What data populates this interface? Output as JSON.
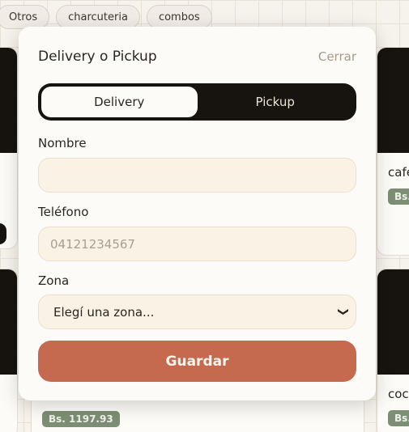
{
  "categories": [
    "Otros",
    "charcuteria",
    "combos"
  ],
  "background": {
    "right_card_1_name": "cafe",
    "right_card_1_price": "Bs.",
    "right_card_2_name": "coc",
    "right_card_2_price": "Bs.",
    "bottom_card_price": "Bs. 1197.93"
  },
  "modal": {
    "title": "Delivery o Pickup",
    "close_label": "Cerrar",
    "toggle": {
      "delivery": "Delivery",
      "pickup": "Pickup",
      "selected": "delivery"
    },
    "name_label": "Nombre",
    "name_value": "",
    "phone_label": "Teléfono",
    "phone_placeholder": "04121234567",
    "zone_label": "Zona",
    "zone_selected": "Elegí una zona...",
    "save_label": "Guardar"
  },
  "colors": {
    "accent": "#c56a4e",
    "dark": "#17130f",
    "badge": "#7c8e74",
    "field_bg": "#fbf2e6"
  }
}
